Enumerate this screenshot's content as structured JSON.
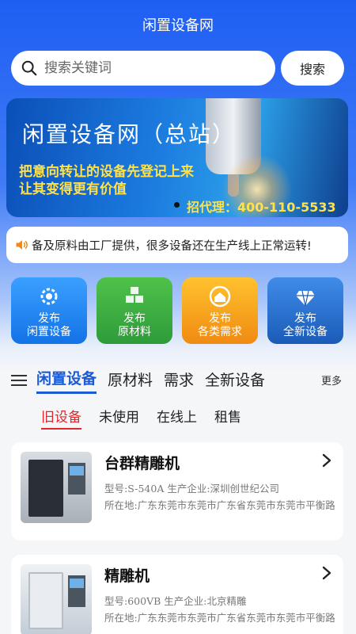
{
  "header": {
    "title": "闲置设备网"
  },
  "search": {
    "placeholder": "搜索关键词",
    "button_label": "搜索"
  },
  "banner": {
    "headline": "闲置设备网（总站）",
    "line1": "把意向转让的设备先登记上来",
    "line2": "让其变得更有价值",
    "phone": "招代理：400-110-5533"
  },
  "notice": {
    "text": "备及原料由工厂提供，很多设备还在生产线上正常运转!"
  },
  "tiles": [
    {
      "line1": "发布",
      "line2": "闲置设备",
      "icon": "gear-icon"
    },
    {
      "line1": "发布",
      "line2": "原材料",
      "icon": "boxes-icon"
    },
    {
      "line1": "发布",
      "line2": "各类需求",
      "icon": "house-icon"
    },
    {
      "line1": "发布",
      "line2": "全新设备",
      "icon": "diamond-icon"
    }
  ],
  "tabs": [
    "闲置设备",
    "原材料",
    "需求",
    "全新设备"
  ],
  "more_label": "更多",
  "subtabs": [
    "旧设备",
    "未使用",
    "在线上",
    "租售"
  ],
  "listings": [
    {
      "name": "台群精雕机",
      "model": "型号:S-540A  生产企业:深圳创世纪公司",
      "location": "所在地:广东东莞市东莞市广东省东莞市东莞市平衡路"
    },
    {
      "name": "精雕机",
      "model": "型号:600VB  生产企业:北京精雕",
      "location": "所在地:广东东莞市东莞市广东省东莞市东莞市平衡路"
    }
  ],
  "colors": {
    "accent": "#1b5bd6",
    "active_subtab": "#e3262d",
    "banner_highlight": "#ffe24a"
  }
}
